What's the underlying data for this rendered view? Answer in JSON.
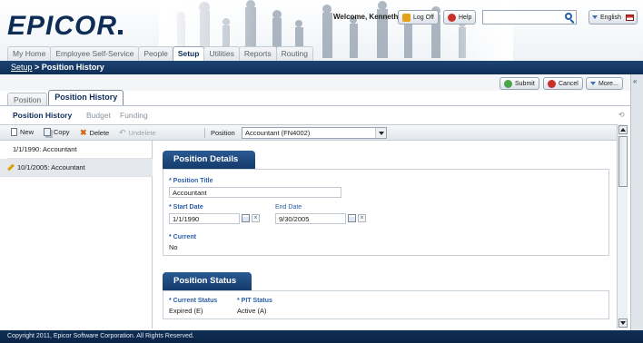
{
  "header": {
    "logo": "EPICOR",
    "welcome": "Welcome, Kenneth",
    "logoff_label": "Log Off",
    "help_label": "Help",
    "search_value": "",
    "language_label": "English",
    "tabs": [
      {
        "label": "My Home"
      },
      {
        "label": "Employee Self-Service"
      },
      {
        "label": "People"
      },
      {
        "label": "Setup"
      },
      {
        "label": "Utilities"
      },
      {
        "label": "Reports"
      },
      {
        "label": "Routing"
      }
    ],
    "active_tab": "Setup"
  },
  "breadcrumb": {
    "root": "Setup",
    "separator": " > ",
    "current": "Position History"
  },
  "actions": {
    "submit": "Submit",
    "cancel": "Cancel",
    "more": "More..."
  },
  "subtabs": [
    {
      "label": "Position"
    },
    {
      "label": "Position History"
    }
  ],
  "pagenav": [
    {
      "label": "Position History"
    },
    {
      "label": "Budget"
    },
    {
      "label": "Funding"
    }
  ],
  "toolbar": {
    "new": "New",
    "copy": "Copy",
    "delete": "Delete",
    "undelete": "Undelete",
    "position_label": "Position",
    "position_value": "Accountant (FN4002)"
  },
  "history_list": [
    {
      "label": "1/1/1990: Accountant"
    },
    {
      "label": "10/1/2005: Accountant"
    }
  ],
  "details": {
    "title": "Position Details",
    "position_title_label": "* Position Title",
    "position_title_value": "Accountant",
    "start_date_label": "* Start Date",
    "start_date_value": "1/1/1990",
    "end_date_label": "End Date",
    "end_date_value": "9/30/2005",
    "current_label": "* Current",
    "current_value": "No"
  },
  "status": {
    "title": "Position Status",
    "current_status_label": "* Current Status",
    "current_status_value": "Expired (E)",
    "pit_status_label": "* PIT Status",
    "pit_status_value": "Active (A)"
  },
  "footer": "Copyright 2011, Epicor Software Corporation. All Rights Reserved.",
  "colors": {
    "navy": "#0d2d57",
    "section_blue": "#1f4b80",
    "label_blue": "#2a5ea8"
  }
}
